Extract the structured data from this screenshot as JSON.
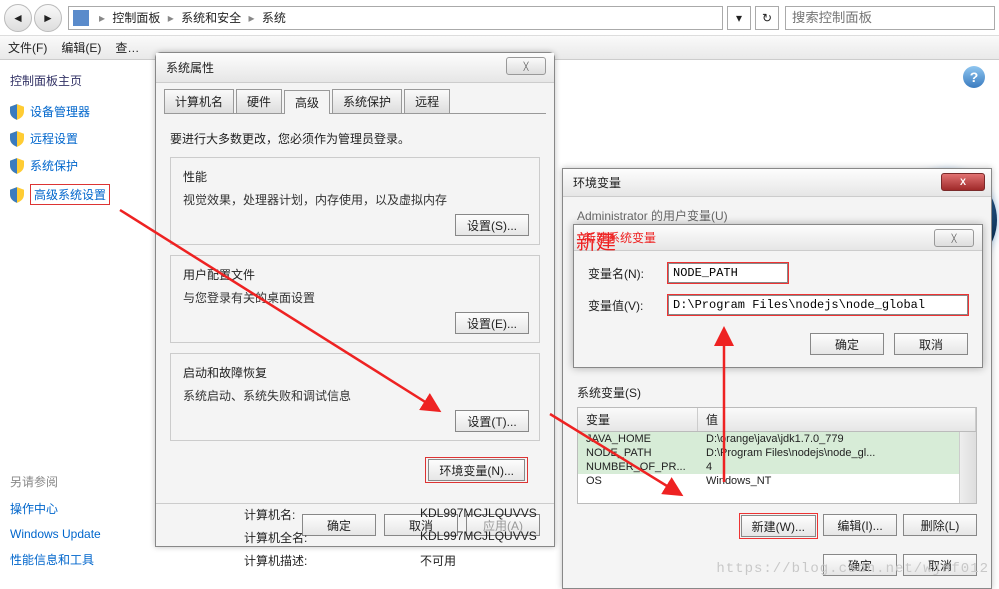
{
  "breadcrumb": {
    "root": "控制面板",
    "l1": "系统和安全",
    "l2": "系统",
    "sep": "▸"
  },
  "search": {
    "placeholder": "搜索控制面板"
  },
  "menubar": {
    "file": "文件(F)",
    "edit": "编辑(E)",
    "view": "查…"
  },
  "leftnav": {
    "title": "控制面板主页",
    "items": [
      "设备管理器",
      "远程设置",
      "系统保护",
      "高级系统设置"
    ]
  },
  "seealso": {
    "hdr": "另请参阅",
    "items": [
      "操作中心",
      "Windows Update",
      "性能信息和工具"
    ]
  },
  "sysprop": {
    "title": "系统属性",
    "tabs": [
      "计算机名",
      "硬件",
      "高级",
      "系统保护",
      "远程"
    ],
    "admin_note": "要进行大多数更改，您必须作为管理员登录。",
    "perf_title": "性能",
    "perf_sub": "视觉效果，处理器计划，内存使用，以及虚拟内存",
    "perf_btn": "设置(S)...",
    "prof_title": "用户配置文件",
    "prof_sub": "与您登录有关的桌面设置",
    "prof_btn": "设置(E)...",
    "boot_title": "启动和故障恢复",
    "boot_sub": "系统启动、系统失败和调试信息",
    "boot_btn": "设置(T)...",
    "env_btn": "环境变量(N)...",
    "ok": "确定",
    "cancel": "取消",
    "apply": "应用(A)"
  },
  "envdlg": {
    "title": "环境变量",
    "user_hdr": "Administrator 的用户变量(U)",
    "sys_hdr": "系统变量(S)",
    "col_name": "变量",
    "col_val": "值",
    "rows": [
      {
        "n": "JAVA_HOME",
        "v": "D:\\orange\\java\\jdk1.7.0_779"
      },
      {
        "n": "NODE_PATH",
        "v": "D:\\Program Files\\nodejs\\node_gl..."
      },
      {
        "n": "NUMBER_OF_PR...",
        "v": "4"
      },
      {
        "n": "OS",
        "v": "Windows_NT"
      }
    ],
    "new": "新建(W)...",
    "edit": "编辑(I)...",
    "del": "删除(L)",
    "ok": "确定",
    "cancel": "取消"
  },
  "newvar": {
    "title": "新建系统变量",
    "name_lbl": "变量名(N):",
    "name_val": "NODE_PATH",
    "val_lbl": "变量值(V):",
    "val_val": "D:\\Program Files\\nodejs\\node_global",
    "ok": "确定",
    "cancel": "取消"
  },
  "annot": {
    "new": "新建"
  },
  "info": {
    "name_k": "计算机名:",
    "name_v": "KDL997MCJLQUVVS",
    "full_k": "计算机全名:",
    "full_v": "KDL997MCJLQUVVS",
    "desc_k": "计算机描述:",
    "desc_v": "不可用"
  },
  "watermark": "https://blog.csdn.net/wjnf012"
}
